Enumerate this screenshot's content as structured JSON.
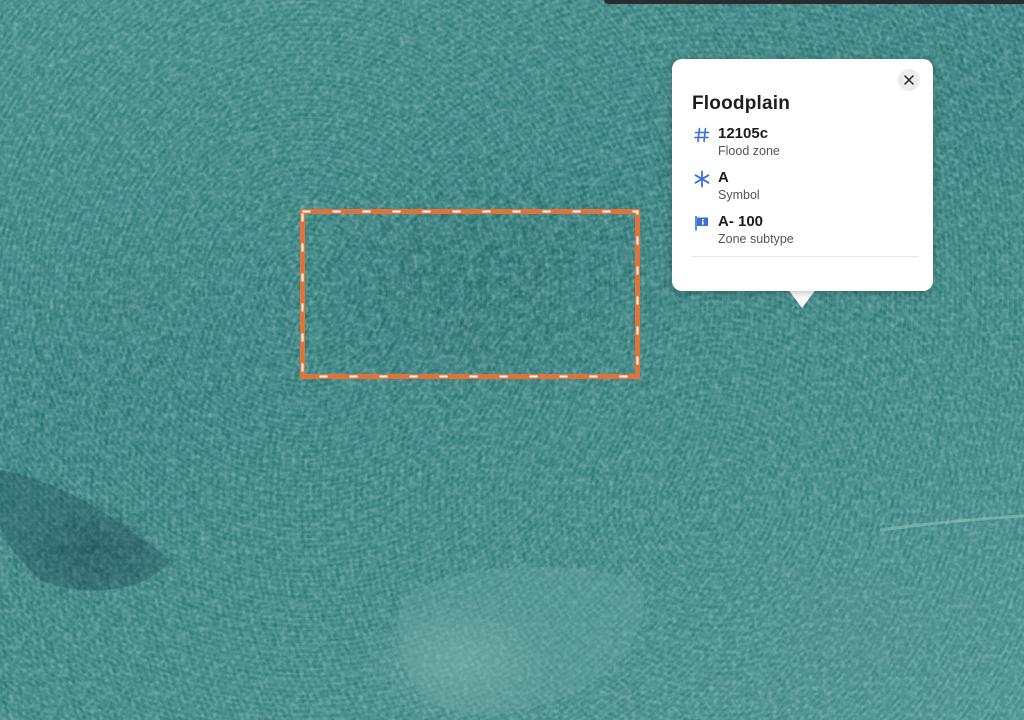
{
  "map": {
    "colors": {
      "selection_outline": "#e0733a",
      "icon_accent": "#3b6fd8"
    }
  },
  "popup": {
    "title": "Floodplain",
    "close_icon": "close-icon",
    "attributes": [
      {
        "icon": "hash-icon",
        "value": "12105c",
        "label": "Flood zone"
      },
      {
        "icon": "asterisk-icon",
        "value": "A",
        "label": "Symbol"
      },
      {
        "icon": "info-flag-icon",
        "value": "A- 100",
        "label": "Zone subtype"
      }
    ]
  }
}
